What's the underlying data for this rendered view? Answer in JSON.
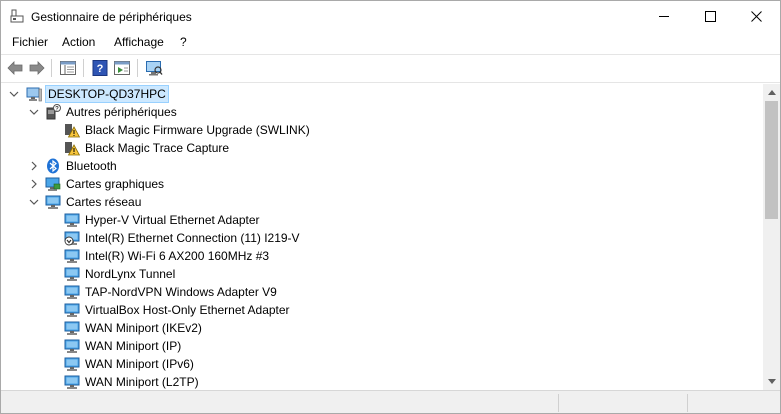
{
  "window": {
    "title": "Gestionnaire de périphériques"
  },
  "menu": [
    {
      "label": "Fichier"
    },
    {
      "label": "Action"
    },
    {
      "label": "Affichage"
    },
    {
      "label": "?"
    }
  ],
  "tree": {
    "root": "DESKTOP-QD37HPC",
    "categories": [
      {
        "label": "Autres périphériques",
        "expanded": true,
        "icon": "other-devices-icon",
        "children": [
          {
            "label": "Black Magic Firmware Upgrade (SWLINK)",
            "icon": "warning-device-icon"
          },
          {
            "label": "Black Magic Trace Capture",
            "icon": "warning-device-icon"
          }
        ]
      },
      {
        "label": "Bluetooth",
        "expanded": false,
        "icon": "bluetooth-icon"
      },
      {
        "label": "Cartes graphiques",
        "expanded": false,
        "icon": "display-adapter-icon"
      },
      {
        "label": "Cartes réseau",
        "expanded": true,
        "icon": "network-adapter-icon",
        "children": [
          {
            "label": "Hyper-V Virtual Ethernet Adapter",
            "icon": "network-adapter-icon"
          },
          {
            "label": "Intel(R) Ethernet Connection (11) I219-V",
            "icon": "network-adapter-disabled-icon"
          },
          {
            "label": "Intel(R) Wi-Fi 6 AX200 160MHz #3",
            "icon": "network-adapter-icon"
          },
          {
            "label": "NordLynx Tunnel",
            "icon": "network-adapter-icon"
          },
          {
            "label": "TAP-NordVPN Windows Adapter V9",
            "icon": "network-adapter-icon"
          },
          {
            "label": "VirtualBox Host-Only Ethernet Adapter",
            "icon": "network-adapter-icon"
          },
          {
            "label": "WAN Miniport (IKEv2)",
            "icon": "network-adapter-icon"
          },
          {
            "label": "WAN Miniport (IP)",
            "icon": "network-adapter-icon"
          },
          {
            "label": "WAN Miniport (IPv6)",
            "icon": "network-adapter-icon"
          },
          {
            "label": "WAN Miniport (L2TP)",
            "icon": "network-adapter-icon"
          }
        ]
      }
    ]
  },
  "colors": {
    "selection": "#cce8ff",
    "accent": "#2b79d1"
  }
}
